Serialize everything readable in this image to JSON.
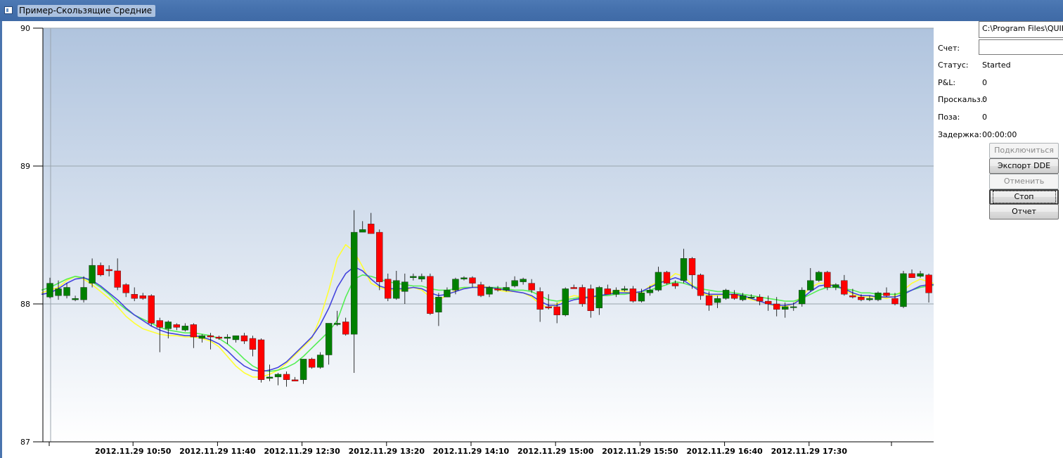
{
  "window": {
    "title": "Пример-Скользящие Средние"
  },
  "panel": {
    "path_value": "C:\\Program Files\\QUIK-...",
    "account_label": "Счет:",
    "account_value": "",
    "status_label": "Статус:",
    "status_value": "Started",
    "pnl_label": "P&L:",
    "pnl_value": "0",
    "slippage_label": "Проскальз.:",
    "slippage_value": "0",
    "position_label": "Поза:",
    "position_value": "0",
    "latency_label": "Задержка:",
    "latency_value": "00:00:00",
    "buttons": {
      "connect": "Подключиться",
      "export_dde": "Экспорт DDE",
      "cancel_orders": "Отменить заявки",
      "stop": "Стоп",
      "report": "Отчет"
    }
  },
  "colors": {
    "candle_up": "#008000",
    "candle_down": "#ff0000",
    "sma_short": "#ffff33",
    "sma_long": "#55ee55",
    "sma_mid": "#4444dd",
    "background_top": "#b0c4de",
    "background_bottom": "#ffffff"
  },
  "chart_data": {
    "type": "candlestick",
    "ylim": [
      87,
      90
    ],
    "yticks": [
      "87",
      "88",
      "89",
      "90"
    ],
    "xtick_labels": [
      "2012.11.29 10:50",
      "2012.11.29 11:40",
      "2012.11.29 12:30",
      "2012.11.29 13:20",
      "2012.11.29 14:10",
      "2012.11.29 15:00",
      "2012.11.29 15:50",
      "2012.11.29 16:40",
      "2012.11.29 17:30"
    ],
    "grid": true,
    "candles": [
      {
        "o": 88.05,
        "h": 88.19,
        "l": 88.04,
        "c": 88.15
      },
      {
        "o": 88.06,
        "h": 88.17,
        "l": 88.03,
        "c": 88.11
      },
      {
        "o": 88.06,
        "h": 88.15,
        "l": 88.04,
        "c": 88.12
      },
      {
        "o": 88.03,
        "h": 88.06,
        "l": 88.02,
        "c": 88.04
      },
      {
        "o": 88.03,
        "h": 88.2,
        "l": 88.01,
        "c": 88.12
      },
      {
        "o": 88.15,
        "h": 88.33,
        "l": 88.12,
        "c": 88.28
      },
      {
        "o": 88.28,
        "h": 88.3,
        "l": 88.2,
        "c": 88.21
      },
      {
        "o": 88.25,
        "h": 88.28,
        "l": 88.2,
        "c": 88.24
      },
      {
        "o": 88.24,
        "h": 88.33,
        "l": 88.1,
        "c": 88.12
      },
      {
        "o": 88.14,
        "h": 88.15,
        "l": 88.05,
        "c": 88.08
      },
      {
        "o": 88.07,
        "h": 88.12,
        "l": 88.02,
        "c": 88.04
      },
      {
        "o": 88.06,
        "h": 88.08,
        "l": 88.03,
        "c": 88.04
      },
      {
        "o": 88.06,
        "h": 88.07,
        "l": 87.84,
        "c": 87.86
      },
      {
        "o": 87.88,
        "h": 87.9,
        "l": 87.65,
        "c": 87.83
      },
      {
        "o": 87.82,
        "h": 87.88,
        "l": 87.75,
        "c": 87.87
      },
      {
        "o": 87.85,
        "h": 87.86,
        "l": 87.81,
        "c": 87.83
      },
      {
        "o": 87.81,
        "h": 87.86,
        "l": 87.8,
        "c": 87.84
      },
      {
        "o": 87.85,
        "h": 87.86,
        "l": 87.68,
        "c": 87.76
      },
      {
        "o": 87.75,
        "h": 87.78,
        "l": 87.72,
        "c": 87.77
      },
      {
        "o": 87.77,
        "h": 87.79,
        "l": 87.67,
        "c": 87.76
      },
      {
        "o": 87.76,
        "h": 87.77,
        "l": 87.74,
        "c": 87.75
      },
      {
        "o": 87.75,
        "h": 87.78,
        "l": 87.71,
        "c": 87.76
      },
      {
        "o": 87.74,
        "h": 87.77,
        "l": 87.72,
        "c": 87.77
      },
      {
        "o": 87.77,
        "h": 87.79,
        "l": 87.71,
        "c": 87.73
      },
      {
        "o": 87.75,
        "h": 87.77,
        "l": 87.62,
        "c": 87.67
      },
      {
        "o": 87.74,
        "h": 87.75,
        "l": 87.43,
        "c": 87.45
      },
      {
        "o": 87.46,
        "h": 87.56,
        "l": 87.44,
        "c": 87.47
      },
      {
        "o": 87.47,
        "h": 87.5,
        "l": 87.41,
        "c": 87.49
      },
      {
        "o": 87.49,
        "h": 87.51,
        "l": 87.4,
        "c": 87.45
      },
      {
        "o": 87.45,
        "h": 87.47,
        "l": 87.44,
        "c": 87.44
      },
      {
        "o": 87.45,
        "h": 87.6,
        "l": 87.42,
        "c": 87.6
      },
      {
        "o": 87.6,
        "h": 87.61,
        "l": 87.53,
        "c": 87.54
      },
      {
        "o": 87.54,
        "h": 87.65,
        "l": 87.53,
        "c": 87.63
      },
      {
        "o": 87.63,
        "h": 87.86,
        "l": 87.56,
        "c": 87.86
      },
      {
        "o": 87.85,
        "h": 87.95,
        "l": 87.84,
        "c": 87.86
      },
      {
        "o": 87.87,
        "h": 87.9,
        "l": 87.77,
        "c": 87.78
      },
      {
        "o": 87.78,
        "h": 88.68,
        "l": 87.5,
        "c": 88.52
      },
      {
        "o": 88.52,
        "h": 88.6,
        "l": 88.52,
        "c": 88.54
      },
      {
        "o": 88.58,
        "h": 88.66,
        "l": 88.51,
        "c": 88.51
      },
      {
        "o": 88.52,
        "h": 88.54,
        "l": 88.1,
        "c": 88.16
      },
      {
        "o": 88.18,
        "h": 88.22,
        "l": 88.02,
        "c": 88.04
      },
      {
        "o": 88.04,
        "h": 88.24,
        "l": 88.03,
        "c": 88.17
      },
      {
        "o": 88.09,
        "h": 88.22,
        "l": 88.0,
        "c": 88.16
      },
      {
        "o": 88.19,
        "h": 88.22,
        "l": 88.17,
        "c": 88.2
      },
      {
        "o": 88.18,
        "h": 88.22,
        "l": 88.16,
        "c": 88.2
      },
      {
        "o": 88.2,
        "h": 88.22,
        "l": 87.92,
        "c": 87.93
      },
      {
        "o": 87.94,
        "h": 88.08,
        "l": 87.84,
        "c": 88.05
      },
      {
        "o": 88.05,
        "h": 88.12,
        "l": 88.05,
        "c": 88.1
      },
      {
        "o": 88.1,
        "h": 88.19,
        "l": 88.07,
        "c": 88.18
      },
      {
        "o": 88.18,
        "h": 88.2,
        "l": 88.17,
        "c": 88.19
      },
      {
        "o": 88.19,
        "h": 88.2,
        "l": 88.12,
        "c": 88.15
      },
      {
        "o": 88.14,
        "h": 88.16,
        "l": 88.05,
        "c": 88.06
      },
      {
        "o": 88.07,
        "h": 88.13,
        "l": 88.05,
        "c": 88.12
      },
      {
        "o": 88.11,
        "h": 88.13,
        "l": 88.09,
        "c": 88.1
      },
      {
        "o": 88.1,
        "h": 88.16,
        "l": 88.09,
        "c": 88.12
      },
      {
        "o": 88.13,
        "h": 88.2,
        "l": 88.12,
        "c": 88.17
      },
      {
        "o": 88.16,
        "h": 88.19,
        "l": 88.14,
        "c": 88.18
      },
      {
        "o": 88.15,
        "h": 88.18,
        "l": 88.08,
        "c": 88.1
      },
      {
        "o": 88.09,
        "h": 88.12,
        "l": 87.87,
        "c": 87.96
      },
      {
        "o": 87.98,
        "h": 88.07,
        "l": 87.96,
        "c": 87.97
      },
      {
        "o": 87.98,
        "h": 88.01,
        "l": 87.86,
        "c": 87.92
      },
      {
        "o": 87.92,
        "h": 88.12,
        "l": 87.91,
        "c": 88.11
      },
      {
        "o": 88.12,
        "h": 88.14,
        "l": 88.11,
        "c": 88.11
      },
      {
        "o": 88.12,
        "h": 88.14,
        "l": 87.98,
        "c": 88.0
      },
      {
        "o": 88.11,
        "h": 88.14,
        "l": 87.9,
        "c": 87.95
      },
      {
        "o": 87.97,
        "h": 88.13,
        "l": 87.92,
        "c": 88.12
      },
      {
        "o": 88.11,
        "h": 88.14,
        "l": 88.08,
        "c": 88.07
      },
      {
        "o": 88.07,
        "h": 88.12,
        "l": 88.05,
        "c": 88.1
      },
      {
        "o": 88.1,
        "h": 88.13,
        "l": 88.09,
        "c": 88.11
      },
      {
        "o": 88.11,
        "h": 88.13,
        "l": 88.01,
        "c": 88.02
      },
      {
        "o": 88.02,
        "h": 88.11,
        "l": 88.01,
        "c": 88.08
      },
      {
        "o": 88.08,
        "h": 88.13,
        "l": 88.06,
        "c": 88.1
      },
      {
        "o": 88.1,
        "h": 88.27,
        "l": 88.09,
        "c": 88.23
      },
      {
        "o": 88.23,
        "h": 88.24,
        "l": 88.14,
        "c": 88.15
      },
      {
        "o": 88.15,
        "h": 88.17,
        "l": 88.11,
        "c": 88.13
      },
      {
        "o": 88.17,
        "h": 88.4,
        "l": 88.15,
        "c": 88.33
      },
      {
        "o": 88.33,
        "h": 88.34,
        "l": 88.11,
        "c": 88.21
      },
      {
        "o": 88.21,
        "h": 88.22,
        "l": 88.03,
        "c": 88.06
      },
      {
        "o": 88.06,
        "h": 88.09,
        "l": 87.95,
        "c": 87.99
      },
      {
        "o": 88.01,
        "h": 88.06,
        "l": 87.97,
        "c": 88.04
      },
      {
        "o": 88.04,
        "h": 88.11,
        "l": 88.03,
        "c": 88.1
      },
      {
        "o": 88.07,
        "h": 88.1,
        "l": 88.03,
        "c": 88.04
      },
      {
        "o": 88.03,
        "h": 88.08,
        "l": 88.02,
        "c": 88.06
      },
      {
        "o": 88.05,
        "h": 88.07,
        "l": 88.04,
        "c": 88.05
      },
      {
        "o": 88.05,
        "h": 88.07,
        "l": 87.99,
        "c": 88.02
      },
      {
        "o": 88.02,
        "h": 88.06,
        "l": 87.95,
        "c": 88.0
      },
      {
        "o": 88.0,
        "h": 88.05,
        "l": 87.91,
        "c": 87.96
      },
      {
        "o": 87.96,
        "h": 88.01,
        "l": 87.9,
        "c": 87.98
      },
      {
        "o": 87.98,
        "h": 88.01,
        "l": 87.95,
        "c": 87.98
      },
      {
        "o": 88.0,
        "h": 88.12,
        "l": 87.98,
        "c": 88.1
      },
      {
        "o": 88.1,
        "h": 88.26,
        "l": 88.09,
        "c": 88.17
      },
      {
        "o": 88.17,
        "h": 88.24,
        "l": 88.16,
        "c": 88.23
      },
      {
        "o": 88.23,
        "h": 88.24,
        "l": 88.1,
        "c": 88.12
      },
      {
        "o": 88.12,
        "h": 88.15,
        "l": 88.1,
        "c": 88.14
      },
      {
        "o": 88.17,
        "h": 88.21,
        "l": 88.06,
        "c": 88.07
      },
      {
        "o": 88.06,
        "h": 88.11,
        "l": 88.04,
        "c": 88.05
      },
      {
        "o": 88.05,
        "h": 88.07,
        "l": 88.02,
        "c": 88.03
      },
      {
        "o": 88.03,
        "h": 88.06,
        "l": 88.02,
        "c": 88.04
      },
      {
        "o": 88.03,
        "h": 88.09,
        "l": 88.02,
        "c": 88.08
      },
      {
        "o": 88.08,
        "h": 88.12,
        "l": 88.05,
        "c": 88.06
      },
      {
        "o": 88.04,
        "h": 88.08,
        "l": 87.99,
        "c": 88.0
      },
      {
        "o": 87.98,
        "h": 88.24,
        "l": 87.97,
        "c": 88.22
      },
      {
        "o": 88.22,
        "h": 88.25,
        "l": 88.19,
        "c": 88.19
      },
      {
        "o": 88.2,
        "h": 88.24,
        "l": 88.19,
        "c": 88.22
      },
      {
        "o": 88.21,
        "h": 88.22,
        "l": 88.01,
        "c": 88.08
      },
      {
        "o": 88.07,
        "h": 88.16,
        "l": 88.06,
        "c": 88.15
      },
      {
        "o": 88.15,
        "h": 88.23,
        "l": 88.14,
        "c": 88.21
      }
    ],
    "series": [
      {
        "type": "line",
        "color": "#ffff33",
        "values": [
          88.08,
          88.1,
          88.12,
          88.17,
          88.2,
          88.18,
          88.14,
          88.09,
          88.04,
          87.98,
          87.91,
          87.86,
          87.82,
          87.8,
          87.78,
          87.77,
          87.77,
          87.76,
          87.76,
          87.75,
          87.73,
          87.69,
          87.62,
          87.55,
          87.5,
          87.47,
          87.47,
          87.49,
          87.52,
          87.57,
          87.63,
          87.69,
          87.75,
          87.9,
          88.1,
          88.33,
          88.43,
          88.38,
          88.27,
          88.15,
          88.12,
          88.1,
          88.1,
          88.1,
          88.12,
          88.1,
          88.05,
          88.03,
          88.06,
          88.1,
          88.12,
          88.12,
          88.13,
          88.12,
          88.1,
          88.09,
          88.09,
          88.08,
          88.05,
          88.0,
          87.97,
          88.0,
          88.04,
          88.06,
          88.05,
          88.04,
          88.05,
          88.07,
          88.1,
          88.09,
          88.08,
          88.08,
          88.13,
          88.16,
          88.17,
          88.22,
          88.2,
          88.14,
          88.08,
          88.06,
          88.06,
          88.07,
          88.06,
          88.05,
          88.03,
          88.02,
          88.0,
          87.98,
          87.98,
          88.0,
          88.06,
          88.12,
          88.15,
          88.15,
          88.13,
          88.1,
          88.07,
          88.05,
          88.05,
          88.05,
          88.04,
          88.06,
          88.1,
          88.15,
          88.18,
          88.16,
          88.14,
          88.16
        ]
      },
      {
        "type": "line",
        "color": "#55ee55",
        "values": [
          88.1,
          88.12,
          88.15,
          88.18,
          88.2,
          88.19,
          88.16,
          88.12,
          88.07,
          88.01,
          87.96,
          87.92,
          87.89,
          87.86,
          87.83,
          87.81,
          87.8,
          87.79,
          87.79,
          87.78,
          87.77,
          87.75,
          87.71,
          87.66,
          87.6,
          87.55,
          87.52,
          87.51,
          87.52,
          87.54,
          87.57,
          87.62,
          87.68,
          87.74,
          87.8,
          87.88,
          88.05,
          88.18,
          88.21,
          88.2,
          88.18,
          88.16,
          88.15,
          88.14,
          88.13,
          88.13,
          88.11,
          88.1,
          88.1,
          88.11,
          88.12,
          88.12,
          88.12,
          88.12,
          88.12,
          88.11,
          88.1,
          88.1,
          88.09,
          88.06,
          88.03,
          88.02,
          88.03,
          88.04,
          88.05,
          88.05,
          88.06,
          88.06,
          88.07,
          88.07,
          88.08,
          88.09,
          88.1,
          88.12,
          88.14,
          88.16,
          88.15,
          88.13,
          88.11,
          88.1,
          88.09,
          88.09,
          88.08,
          88.07,
          88.06,
          88.05,
          88.04,
          88.03,
          88.02,
          88.02,
          88.04,
          88.07,
          88.1,
          88.12,
          88.12,
          88.11,
          88.1,
          88.08,
          88.08,
          88.07,
          88.07,
          88.07,
          88.08,
          88.1,
          88.12,
          88.13,
          88.14,
          88.15
        ]
      },
      {
        "type": "line",
        "color": "#4444dd",
        "values": [
          88.07,
          88.08,
          88.11,
          88.15,
          88.18,
          88.19,
          88.17,
          88.13,
          88.08,
          88.03,
          87.97,
          87.92,
          87.88,
          87.84,
          87.81,
          87.79,
          87.78,
          87.77,
          87.77,
          87.76,
          87.74,
          87.71,
          87.66,
          87.6,
          87.55,
          87.52,
          87.51,
          87.52,
          87.54,
          87.58,
          87.64,
          87.7,
          87.76,
          87.85,
          87.97,
          88.12,
          88.22,
          88.27,
          88.24,
          88.18,
          88.13,
          88.11,
          88.11,
          88.11,
          88.12,
          88.11,
          88.08,
          88.06,
          88.07,
          88.09,
          88.11,
          88.12,
          88.12,
          88.12,
          88.11,
          88.1,
          88.09,
          88.08,
          88.06,
          88.02,
          87.99,
          87.99,
          88.01,
          88.03,
          88.04,
          88.05,
          88.06,
          88.07,
          88.08,
          88.08,
          88.08,
          88.09,
          88.12,
          88.15,
          88.17,
          88.19,
          88.17,
          88.13,
          88.09,
          88.07,
          88.07,
          88.07,
          88.07,
          88.06,
          88.04,
          88.02,
          88.0,
          87.99,
          87.99,
          88.0,
          88.04,
          88.09,
          88.13,
          88.14,
          88.13,
          88.11,
          88.08,
          88.06,
          88.06,
          88.05,
          88.05,
          88.05,
          88.07,
          88.1,
          88.13,
          88.14,
          88.14,
          88.15
        ]
      }
    ]
  }
}
